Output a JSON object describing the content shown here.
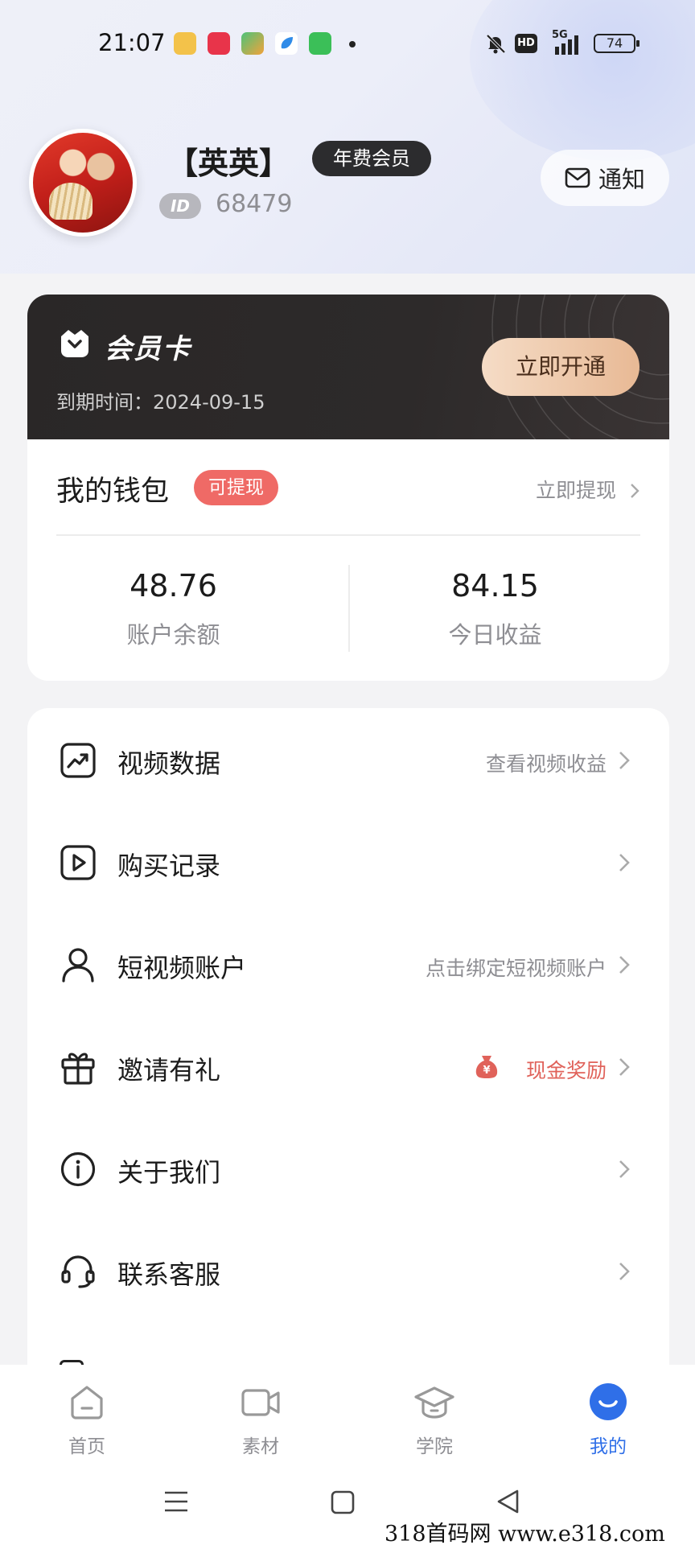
{
  "status_bar": {
    "time": "21:07",
    "battery": "74",
    "network": "5G",
    "hd": "HD"
  },
  "profile": {
    "username": "【英英】",
    "member_badge": "年费会员",
    "id_label": "ID",
    "id_value": "68479",
    "notify_label": "通知"
  },
  "member_card": {
    "title": "会员卡",
    "expire_text": "到期时间：2024-09-15",
    "open_button": "立即开通"
  },
  "wallet": {
    "title": "我的钱包",
    "tag": "可提现",
    "withdraw_link": "立即提现",
    "balance_value": "48.76",
    "balance_label": "账户余额",
    "today_value": "84.15",
    "today_label": "今日收益"
  },
  "menu": {
    "items": [
      {
        "label": "视频数据",
        "hint": "查看视频收益",
        "icon": "chart-trend-icon"
      },
      {
        "label": "购买记录",
        "hint": "",
        "icon": "play-square-icon"
      },
      {
        "label": "短视频账户",
        "hint": "点击绑定短视频账户",
        "icon": "user-icon"
      },
      {
        "label": "邀请有礼",
        "hint": "现金奖励",
        "icon": "gift-icon"
      },
      {
        "label": "关于我们",
        "hint": "",
        "icon": "info-circle-icon"
      },
      {
        "label": "联系客服",
        "hint": "",
        "icon": "headset-icon"
      }
    ]
  },
  "bottom_nav": {
    "items": [
      {
        "label": "首页",
        "icon": "home-icon"
      },
      {
        "label": "素材",
        "icon": "video-camera-icon"
      },
      {
        "label": "学院",
        "icon": "graduation-cap-icon"
      },
      {
        "label": "我的",
        "icon": "profile-smile-icon"
      }
    ],
    "active_color": "#2f6fe8"
  },
  "watermark": "318首码网  www.e318.com",
  "colors": {
    "accent_blue": "#2f6fe8",
    "tag_red": "#ef6a66",
    "card_dark": "#2a2727",
    "gold_button": "#e8b995"
  }
}
